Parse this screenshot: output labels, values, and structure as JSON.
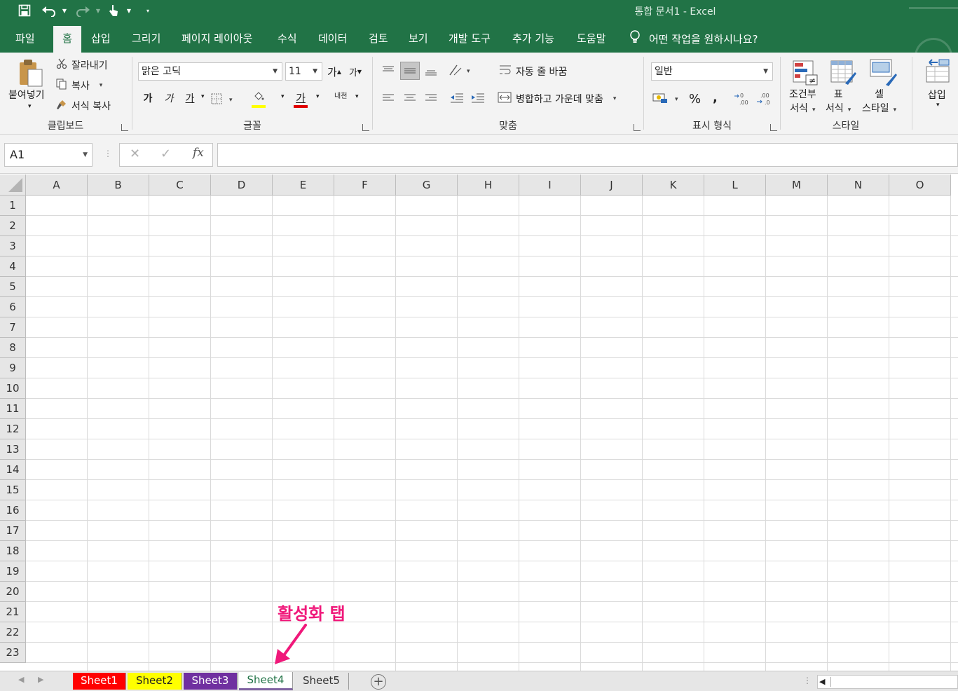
{
  "window": {
    "doc_title": "통합 문서1  -  Excel",
    "accent_color": "#217346"
  },
  "quick_access": {
    "save_icon": "save-icon",
    "undo_icon": "undo-icon",
    "redo_icon": "redo-icon",
    "touch_icon": "touch-mode-icon",
    "customize_icon": "customize-qat-icon"
  },
  "tabs": [
    {
      "label": "파일"
    },
    {
      "label": "홈"
    },
    {
      "label": "삽입"
    },
    {
      "label": "그리기"
    },
    {
      "label": "페이지 레이아웃"
    },
    {
      "label": "수식"
    },
    {
      "label": "데이터"
    },
    {
      "label": "검토"
    },
    {
      "label": "보기"
    },
    {
      "label": "개발 도구"
    },
    {
      "label": "추가 기능"
    },
    {
      "label": "도움말"
    }
  ],
  "active_tab": "홈",
  "tell_me": "어떤 작업을 원하시나요?",
  "ribbon": {
    "clipboard": {
      "group_label": "클립보드",
      "paste": "붙여넣기",
      "cut": "잘라내기",
      "copy": "복사",
      "format_painter": "서식 복사"
    },
    "font": {
      "group_label": "글꼴",
      "font_name": "맑은 고딕",
      "font_size": "11",
      "grow": "가",
      "shrink": "가",
      "bold": "가",
      "italic": "가",
      "underline": "가",
      "font_color_glyph": "가",
      "phonetic": "내천",
      "fill_color": "#ffff00",
      "font_color": "#e00000"
    },
    "alignment": {
      "group_label": "맞춤",
      "wrap_text": "자동 줄 바꿈",
      "merge_center": "병합하고 가운데 맞춤"
    },
    "number": {
      "group_label": "표시 형식",
      "format": "일반",
      "percent": "%",
      "comma": ","
    },
    "styles": {
      "group_label": "스타일",
      "conditional_1": "조건부",
      "conditional_2": "서식",
      "table_1": "표",
      "table_2": "서식",
      "cell_1": "셀",
      "cell_2": "스타일"
    },
    "cells": {
      "insert": "삽입"
    }
  },
  "formula_bar": {
    "name_box": "A1",
    "fx": "fx",
    "formula": ""
  },
  "grid": {
    "columns": [
      "A",
      "B",
      "C",
      "D",
      "E",
      "F",
      "G",
      "H",
      "I",
      "J",
      "K",
      "L",
      "M",
      "N",
      "O"
    ],
    "rows": [
      "1",
      "2",
      "3",
      "4",
      "5",
      "6",
      "7",
      "8",
      "9",
      "10",
      "11",
      "12",
      "13",
      "14",
      "15",
      "16",
      "17",
      "18",
      "19",
      "20",
      "21",
      "22",
      "23"
    ]
  },
  "annotation": {
    "text": "활성화 탭",
    "color": "#f0187a"
  },
  "sheets": [
    {
      "name": "Sheet1",
      "color": "#ff0000",
      "text_color": "#ffffff",
      "active": false
    },
    {
      "name": "Sheet2",
      "color": "#ffff00",
      "text_color": "#222222",
      "active": false
    },
    {
      "name": "Sheet3",
      "color": "#7030a0",
      "text_color": "#ffffff",
      "active": false
    },
    {
      "name": "Sheet4",
      "color": "#8064a2",
      "text_color": "#217346",
      "active": true
    },
    {
      "name": "Sheet5",
      "color": "",
      "text_color": "#333333",
      "active": false
    }
  ]
}
